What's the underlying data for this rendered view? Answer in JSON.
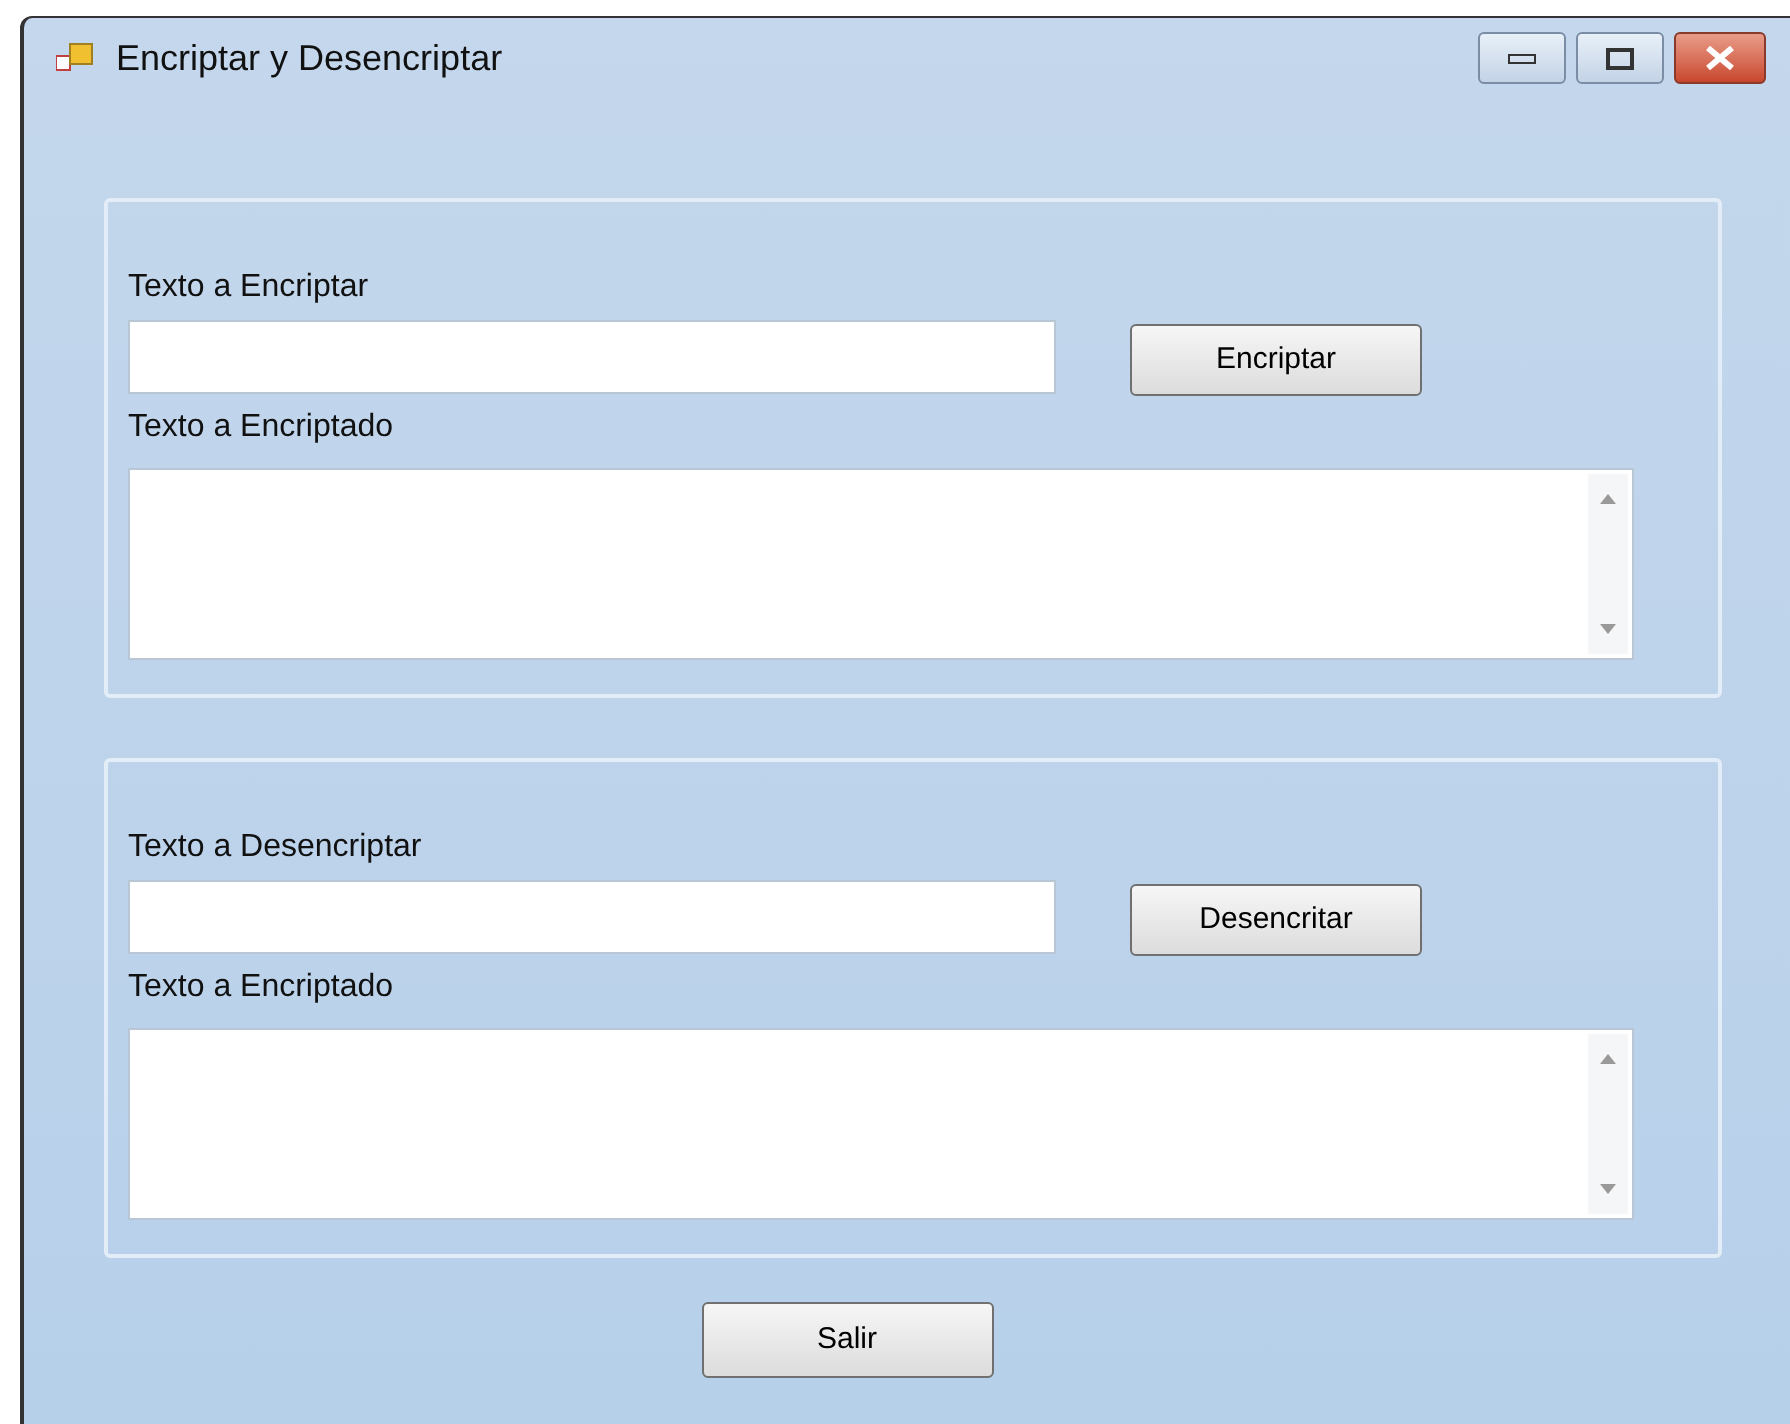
{
  "window": {
    "title": "Encriptar y Desencriptar"
  },
  "sections": [
    {
      "input_label": "Texto a Encriptar",
      "button": "Encriptar",
      "output_label": "Texto a Encriptado"
    },
    {
      "input_label": "Texto a Desencriptar",
      "button": "Desencritar",
      "output_label": "Texto a Encriptado"
    }
  ],
  "exit_button": "Salir"
}
